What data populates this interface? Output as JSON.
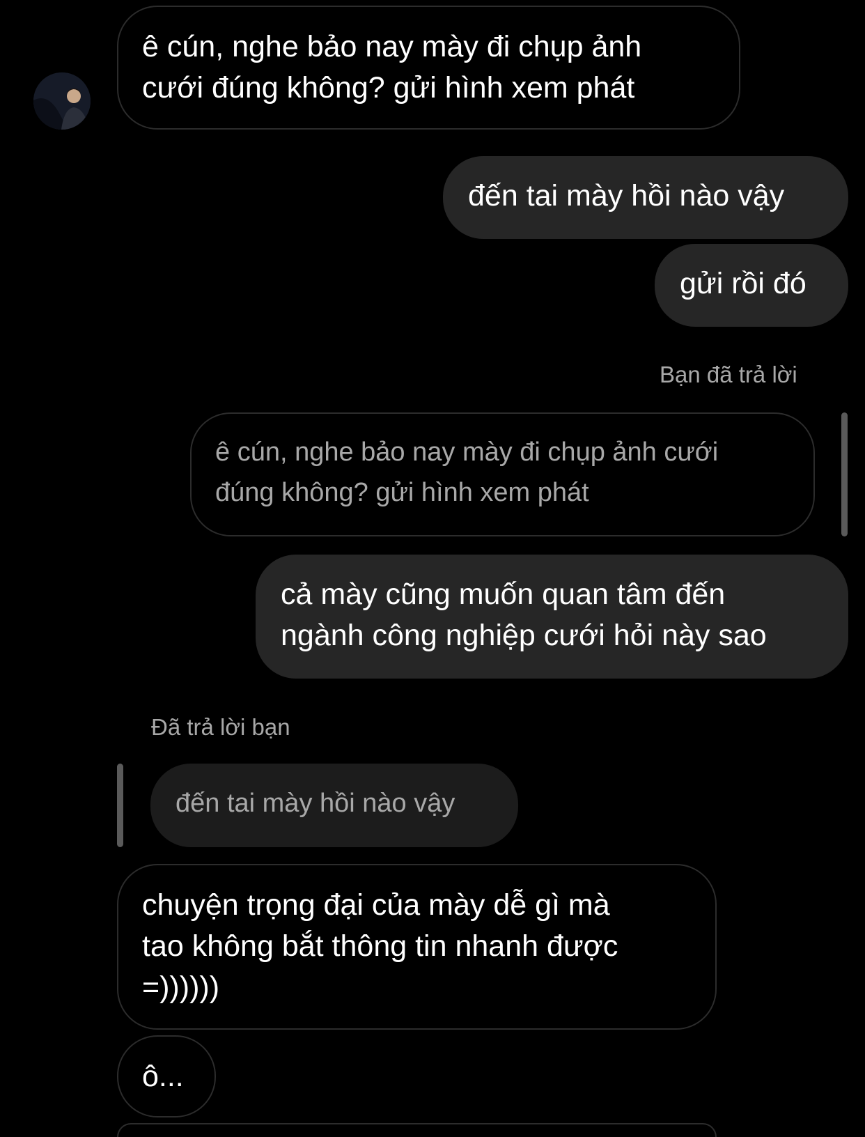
{
  "thread": {
    "msg1": {
      "line1": "ê cún, nghe bảo nay mày đi chụp ảnh",
      "line2": "cưới đúng không? gửi hình xem phát"
    },
    "msg2": {
      "text": "đến tai mày hồi nào vậy"
    },
    "msg3": {
      "text": "gửi rồi đó"
    },
    "reply_out": {
      "label": "Bạn đã trả lời",
      "quoted_line1": "ê cún, nghe bảo nay mày đi chụp ảnh cưới",
      "quoted_line2": "đúng không? gửi hình xem phát",
      "line1": "cả mày cũng muốn quan tâm đến",
      "line2": "ngành công nghiệp cưới hỏi này sao"
    },
    "reply_in": {
      "label": "Đã trả lời bạn",
      "quoted": "đến tai mày hồi nào vậy",
      "line1": "chuyện trọng đại của mày dễ gì mà",
      "line2": "tao không bắt thông tin nhanh được",
      "line3": "=))))))"
    },
    "msg_last": {
      "text": "ô..."
    }
  },
  "colors": {
    "background": "#000000",
    "outgoing_bubble": "#262626",
    "incoming_border": "#2c2c2c",
    "secondary_text": "#a8a8a8"
  },
  "icons": {
    "avatar": "user-avatar-photo"
  }
}
